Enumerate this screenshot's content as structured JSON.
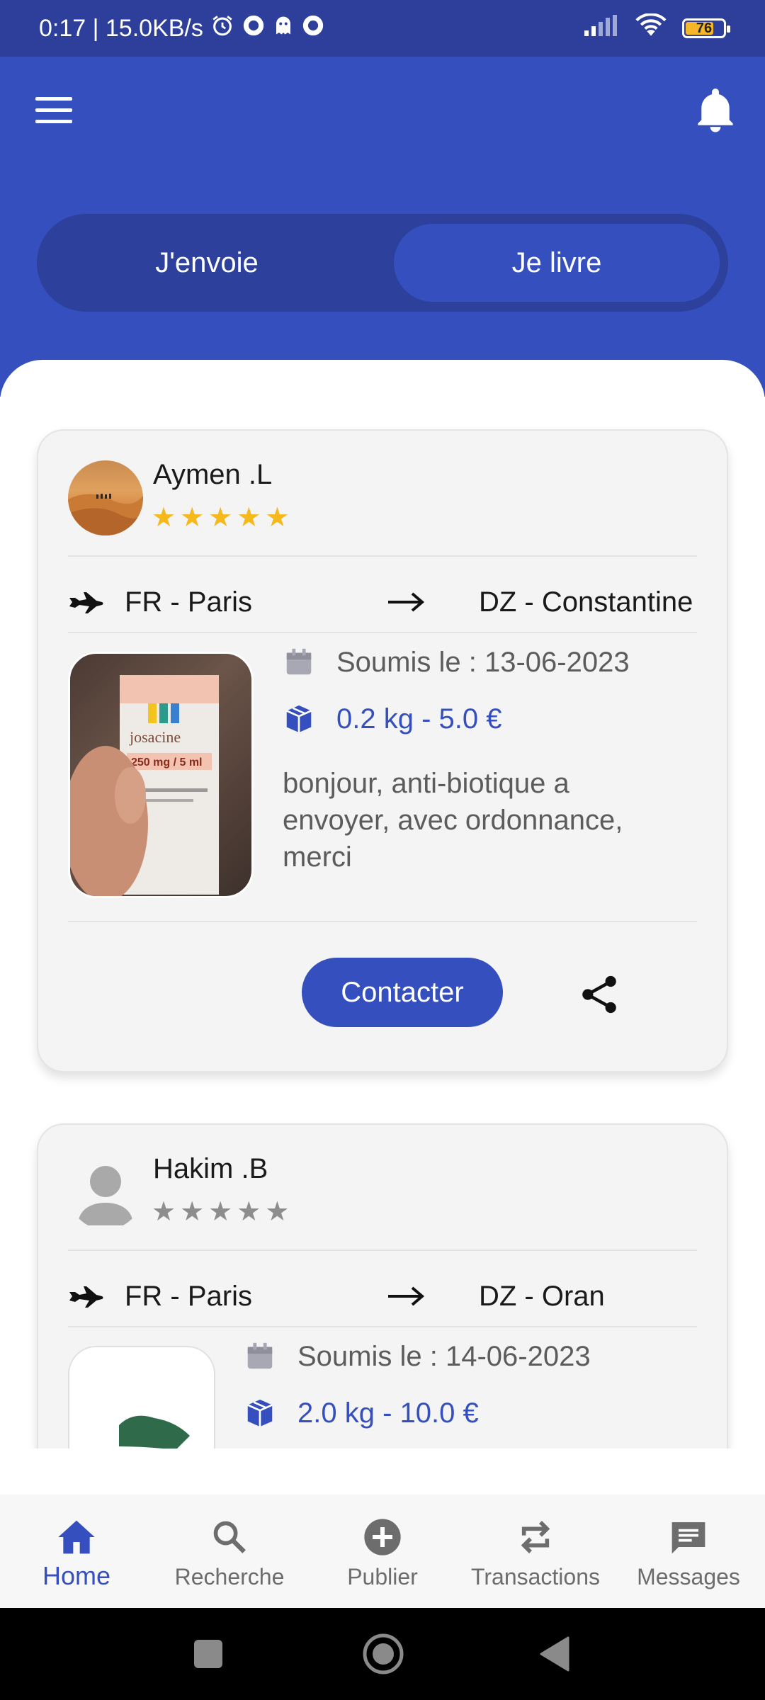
{
  "status": {
    "time_speed": "0:17 | 15.0KB/s",
    "battery": "76"
  },
  "toggle": {
    "send_label": "J'envoie",
    "deliver_label": "Je livre"
  },
  "listings": [
    {
      "user": "Aymen .L",
      "rating": 5,
      "from": "FR - Paris",
      "to": "DZ - Constantine",
      "submitted": "Soumis le : 13-06-2023",
      "weight_price": "0.2 kg - 5.0 €",
      "description": "bonjour, anti-biotique a envoyer, avec ordonnance, merci",
      "contact_label": "Contacter"
    },
    {
      "user": "Hakim .B",
      "rating": 0,
      "from": "FR - Paris",
      "to": "DZ - Oran",
      "submitted": "Soumis le : 14-06-2023",
      "weight_price": "2.0 kg - 10.0 €"
    }
  ],
  "photo_label": {
    "brand": "josacine",
    "dose": "250 mg / 5 ml"
  },
  "nav": [
    {
      "label": "Home",
      "icon": "home-icon",
      "active": true
    },
    {
      "label": "Recherche",
      "icon": "search-icon",
      "active": false
    },
    {
      "label": "Publier",
      "icon": "add-circle-icon",
      "active": false
    },
    {
      "label": "Transactions",
      "icon": "swap-icon",
      "active": false
    },
    {
      "label": "Messages",
      "icon": "message-icon",
      "active": false
    }
  ],
  "colors": {
    "primary": "#3550be",
    "primary_dark": "#2d409c",
    "star_active": "#f6b91b",
    "star_inactive": "#8d8d8d"
  }
}
